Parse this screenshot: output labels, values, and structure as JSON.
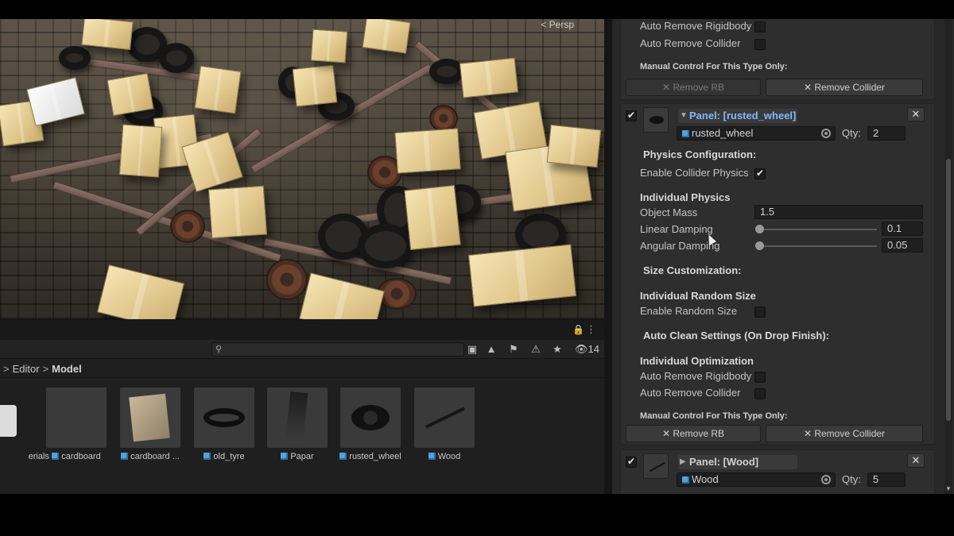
{
  "scene": {
    "view_mode": "< Persp"
  },
  "project": {
    "visible_count": "14",
    "breadcrumb": {
      "parent": "Editor",
      "current": "Model",
      "separator": ">"
    },
    "assets": [
      {
        "label": "erials",
        "type": "folder"
      },
      {
        "label": "cardboard",
        "type": "prefab"
      },
      {
        "label": "cardboard ...",
        "type": "prefab"
      },
      {
        "label": "old_tyre",
        "type": "prefab"
      },
      {
        "label": "Papar",
        "type": "prefab"
      },
      {
        "label": "rusted_wheel",
        "type": "prefab"
      },
      {
        "label": "Wood",
        "type": "prefab"
      }
    ]
  },
  "inspector": {
    "top": {
      "auto_remove_rigidbody": "Auto Remove Rigidbody",
      "auto_remove_collider": "Auto Remove Collider",
      "manual_control": "Manual Control For This Type Only:",
      "remove_rb": "✕ Remove RB",
      "remove_collider": "✕ Remove Collider"
    },
    "rusted_panel": {
      "title": "Panel: [rusted_wheel]",
      "object": "rusted_wheel",
      "qty_label": "Qty:",
      "qty": "2",
      "physics_config": "Physics Configuration:",
      "enable_collider": "Enable Collider Physics",
      "individual_physics": "Individual Physics",
      "object_mass_label": "Object Mass",
      "object_mass": "1.5",
      "linear_damping_label": "Linear Damping",
      "linear_damping": "0.1",
      "angular_damping_label": "Angular Damping",
      "angular_damping": "0.05",
      "size_custom": "Size Customization:",
      "individual_random": "Individual Random Size",
      "enable_random": "Enable Random Size",
      "auto_clean": "Auto Clean Settings (On Drop Finish):",
      "individual_opt": "Individual Optimization",
      "auto_remove_rigidbody": "Auto Remove Rigidbody",
      "auto_remove_collider": "Auto Remove Collider",
      "manual_control": "Manual Control For This Type Only:",
      "remove_rb": "✕ Remove RB",
      "remove_collider": "✕ Remove Collider"
    },
    "wood_panel": {
      "title": "Panel: [Wood]",
      "object": "Wood",
      "qty_label": "Qty:",
      "qty": "5"
    },
    "close": "✕"
  },
  "colors": {
    "panel_header": "#7fb8ff",
    "prefab_icon": "#4fa3e0"
  }
}
